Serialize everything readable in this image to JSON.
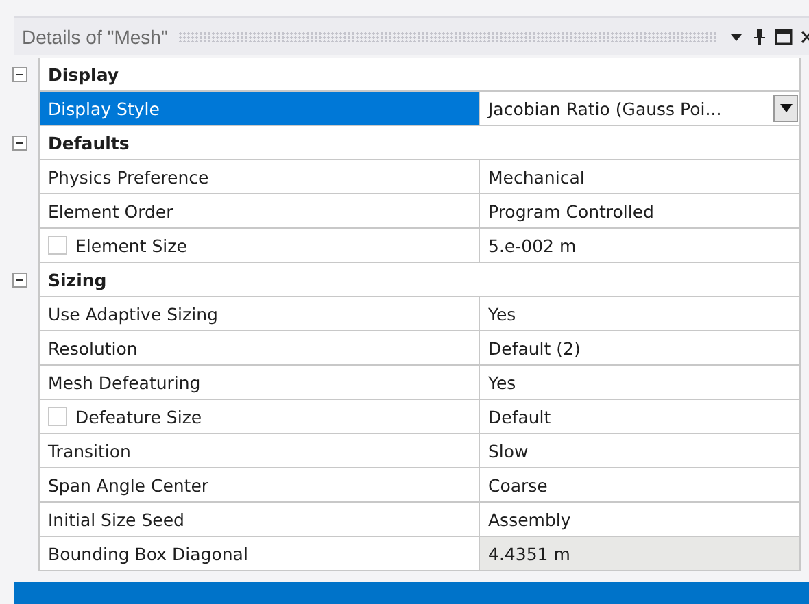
{
  "panel": {
    "title": "Details of \"Mesh\""
  },
  "groups": [
    {
      "label": "Display",
      "expanded": true,
      "properties": [
        {
          "name": "Display Style",
          "value": "Jacobian Ratio (Gauss Poi...",
          "kind": "dropdown",
          "selected": true,
          "readonly": false
        }
      ]
    },
    {
      "label": "Defaults",
      "expanded": true,
      "properties": [
        {
          "name": "Physics Preference",
          "value": "Mechanical",
          "kind": "text",
          "selected": false,
          "readonly": false
        },
        {
          "name": "Element Order",
          "value": "Program Controlled",
          "kind": "text",
          "selected": false,
          "readonly": false
        },
        {
          "name": "Element Size",
          "value": "5.e-002 m",
          "kind": "check",
          "checked": false,
          "selected": false,
          "readonly": false
        }
      ]
    },
    {
      "label": "Sizing",
      "expanded": true,
      "properties": [
        {
          "name": "Use Adaptive Sizing",
          "value": "Yes",
          "kind": "text",
          "selected": false,
          "readonly": false
        },
        {
          "name": "Resolution",
          "value": "Default (2)",
          "kind": "text",
          "selected": false,
          "readonly": false
        },
        {
          "name": "Mesh Defeaturing",
          "value": "Yes",
          "kind": "text",
          "selected": false,
          "readonly": false
        },
        {
          "name": "Defeature Size",
          "value": "Default",
          "kind": "check",
          "checked": false,
          "selected": false,
          "readonly": false
        },
        {
          "name": "Transition",
          "value": "Slow",
          "kind": "text",
          "selected": false,
          "readonly": false
        },
        {
          "name": "Span Angle Center",
          "value": "Coarse",
          "kind": "text",
          "selected": false,
          "readonly": false
        },
        {
          "name": "Initial Size Seed",
          "value": "Assembly",
          "kind": "text",
          "selected": false,
          "readonly": false
        },
        {
          "name": "Bounding Box Diagonal",
          "value": "4.4351 m",
          "kind": "text",
          "selected": false,
          "readonly": true
        }
      ]
    }
  ]
}
